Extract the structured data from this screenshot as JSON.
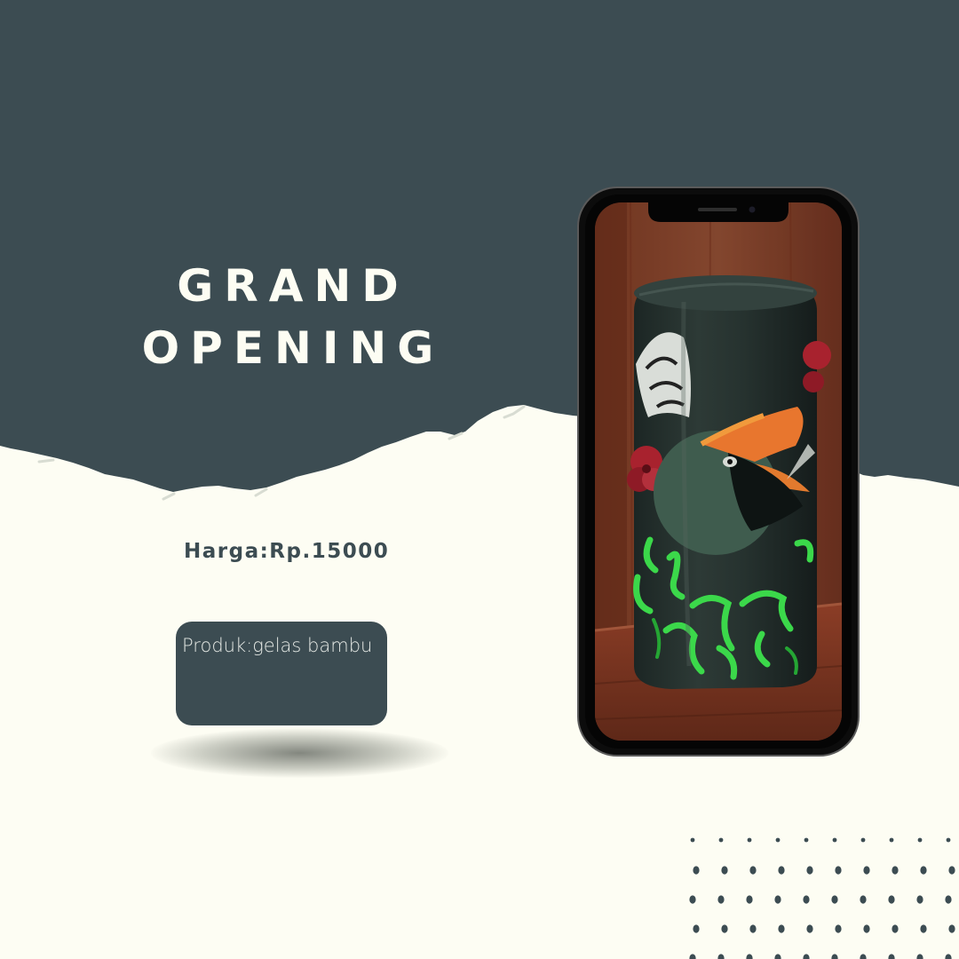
{
  "headline": {
    "line1": "GRAND",
    "line2": "OPENING"
  },
  "price": "Harga:Rp.15000",
  "product_label": "Produk:gelas bambu",
  "colors": {
    "dark_teal": "#3c4c52",
    "cream": "#fdfdf3",
    "grid_pink": "#e98aa8",
    "grid_purple": "#9d8fd4"
  },
  "icons": {
    "grid_pattern": "grid-pattern-icon",
    "dot_pattern": "dot-pattern-icon"
  }
}
